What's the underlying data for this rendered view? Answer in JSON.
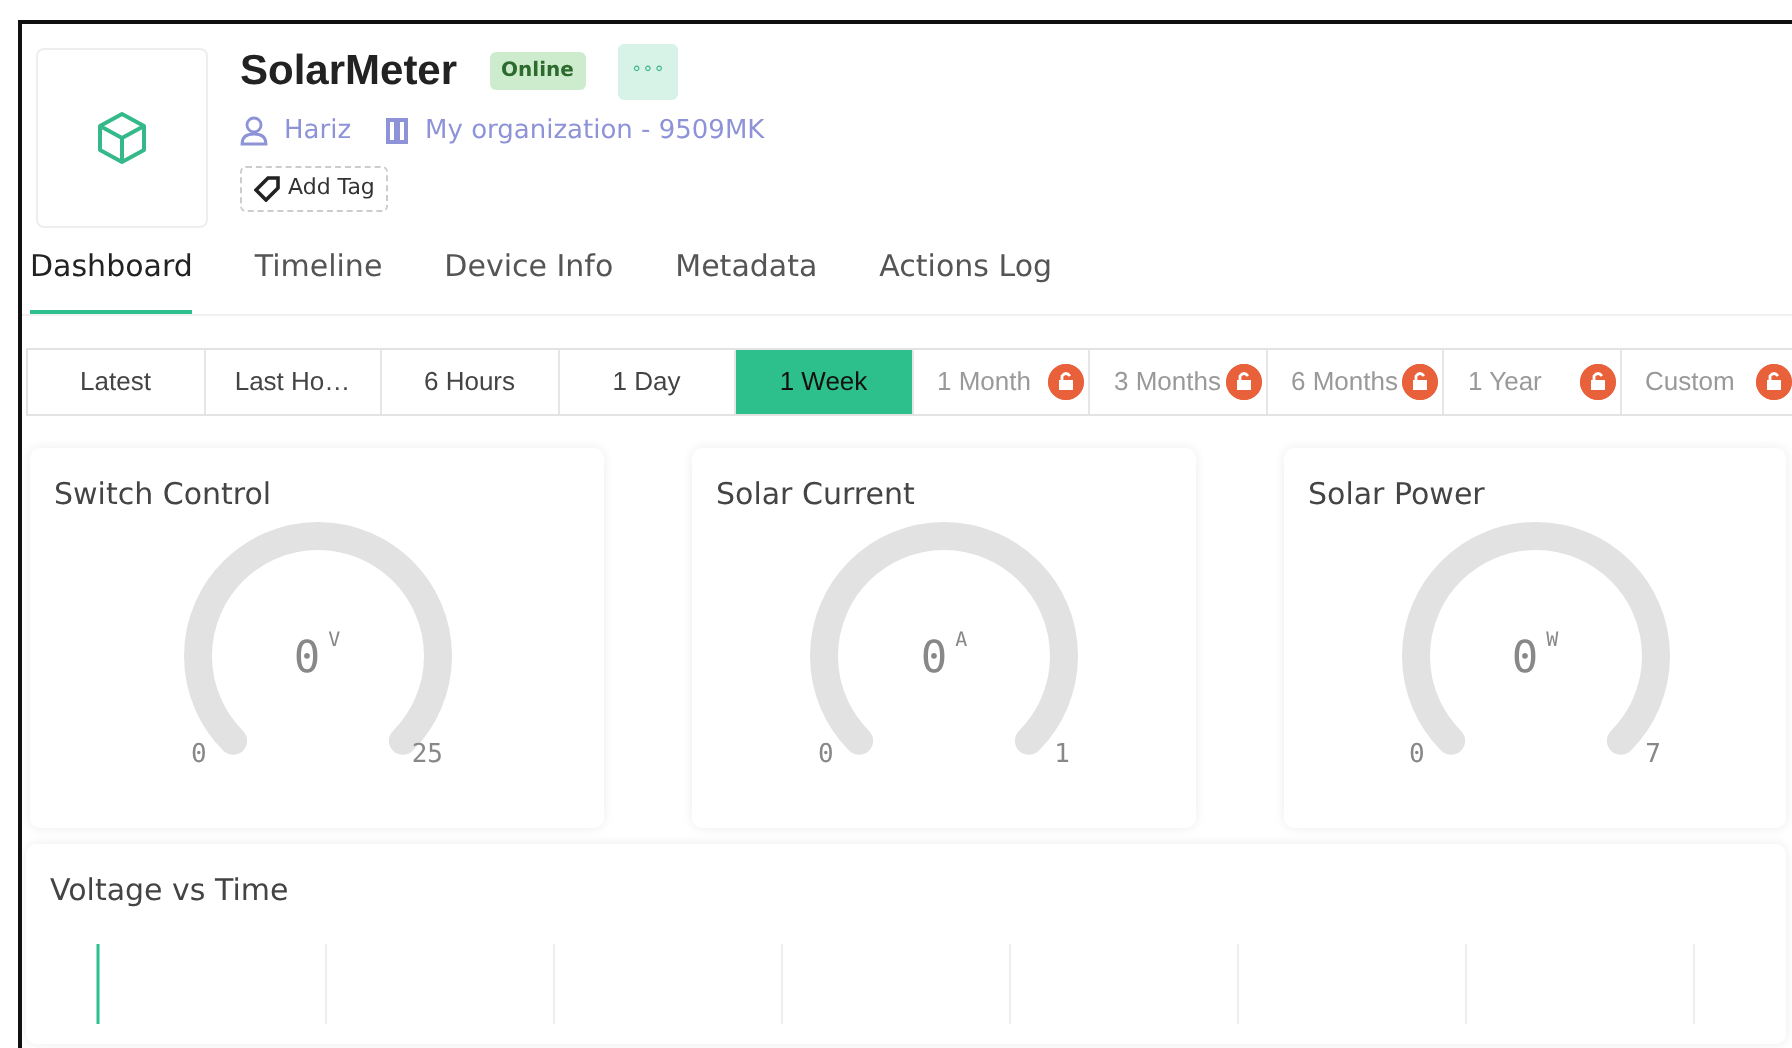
{
  "device": {
    "name": "SolarMeter",
    "status": "Online",
    "more": "∘∘∘",
    "owner": "Hariz",
    "organization": "My organization - 9509MK",
    "add_tag": "Add Tag"
  },
  "tabs": [
    {
      "label": "Dashboard",
      "selected": true
    },
    {
      "label": "Timeline",
      "selected": false
    },
    {
      "label": "Device Info",
      "selected": false
    },
    {
      "label": "Metadata",
      "selected": false
    },
    {
      "label": "Actions Log",
      "selected": false
    }
  ],
  "ranges": [
    {
      "label": "Latest",
      "selected": false,
      "locked": false
    },
    {
      "label": "Last Ho…",
      "selected": false,
      "locked": false
    },
    {
      "label": "6 Hours",
      "selected": false,
      "locked": false
    },
    {
      "label": "1 Day",
      "selected": false,
      "locked": false
    },
    {
      "label": "1 Week",
      "selected": true,
      "locked": false
    },
    {
      "label": "1 Month",
      "selected": false,
      "locked": true
    },
    {
      "label": "3 Months",
      "selected": false,
      "locked": true
    },
    {
      "label": "6 Months",
      "selected": false,
      "locked": true
    },
    {
      "label": "1 Year",
      "selected": false,
      "locked": true
    },
    {
      "label": "Custom",
      "selected": false,
      "locked": true
    }
  ],
  "gauges": [
    {
      "title": "Switch Control",
      "value": "0",
      "unit": "V",
      "min": "0",
      "max": "25"
    },
    {
      "title": "Solar Current",
      "value": "0",
      "unit": "A",
      "min": "0",
      "max": "1"
    },
    {
      "title": "Solar Power",
      "value": "0",
      "unit": "W",
      "min": "0",
      "max": "7"
    }
  ],
  "chart": {
    "title": "Voltage vs Time"
  }
}
